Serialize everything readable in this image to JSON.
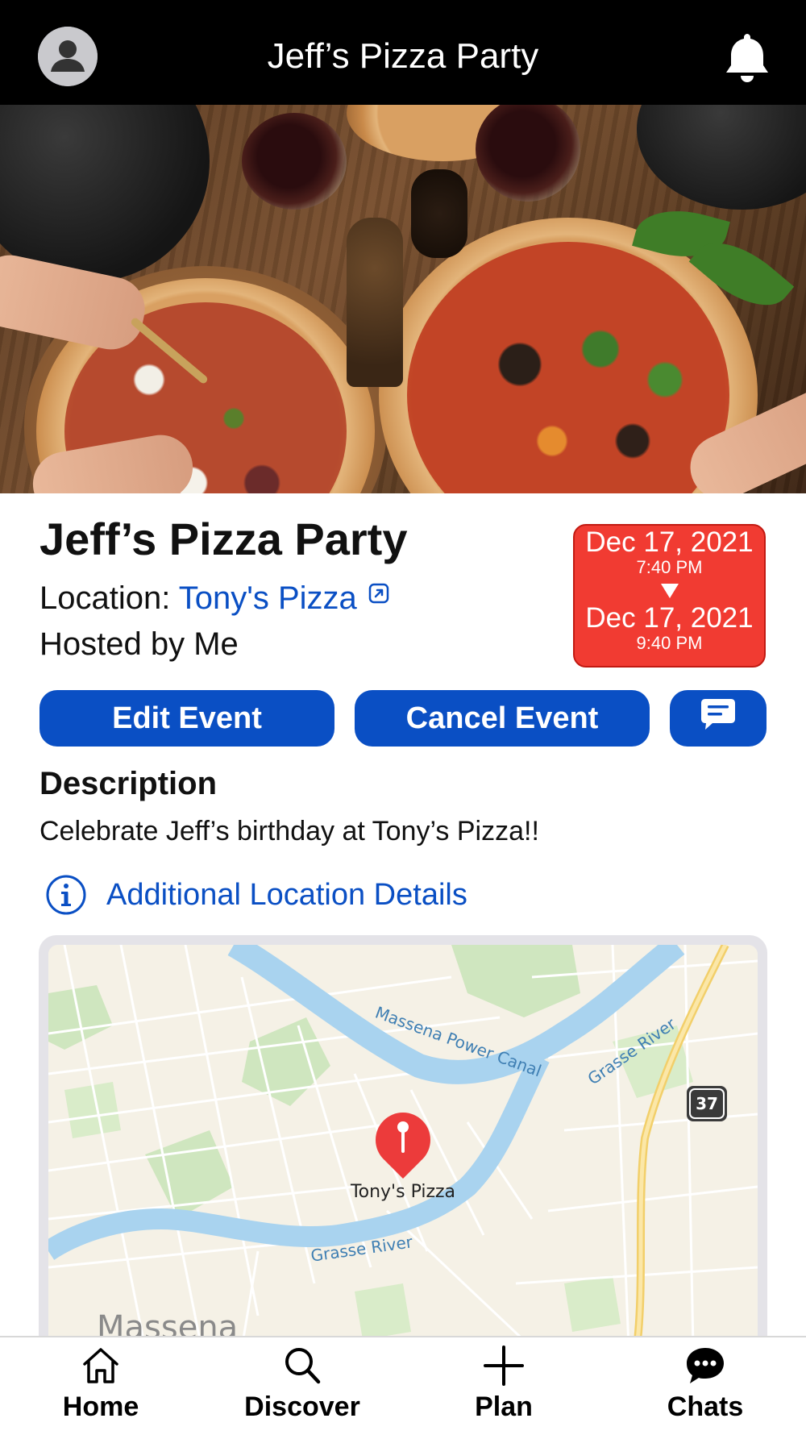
{
  "header": {
    "title": "Jeff’s Pizza Party",
    "profile_icon": "person-circle-icon",
    "notification_icon": "bell-icon"
  },
  "event": {
    "title": "Jeff’s Pizza Party",
    "location_label": "Location: ",
    "location_name": "Tony's Pizza",
    "host_text": "Hosted by Me",
    "start_date": "Dec 17, 2021",
    "start_time": "7:40 PM",
    "end_date": "Dec 17, 2021",
    "end_time": "9:40 PM"
  },
  "actions": {
    "edit_label": "Edit Event",
    "cancel_label": "Cancel Event",
    "chat_icon": "message-icon"
  },
  "description": {
    "heading": "Description",
    "text": "Celebrate Jeff’s birthday at Tony’s Pizza!!"
  },
  "location_details": {
    "label": "Additional Location Details",
    "icon": "info-circle-icon"
  },
  "map": {
    "pin_label": "Tony's Pizza",
    "labels": {
      "canal": "Massena Power Canal",
      "river_north": "Grasse River",
      "river_south": "Grasse River",
      "town": "Massena",
      "route": "37"
    }
  },
  "tabbar": {
    "items": [
      {
        "label": "Home",
        "icon": "home-icon"
      },
      {
        "label": "Discover",
        "icon": "search-icon"
      },
      {
        "label": "Plan",
        "icon": "plus-icon"
      },
      {
        "label": "Chats",
        "icon": "chat-bubble-icon"
      }
    ]
  },
  "colors": {
    "accent": "#0a4fc4",
    "date_badge": "#f13b32",
    "top_bar": "#000000"
  }
}
